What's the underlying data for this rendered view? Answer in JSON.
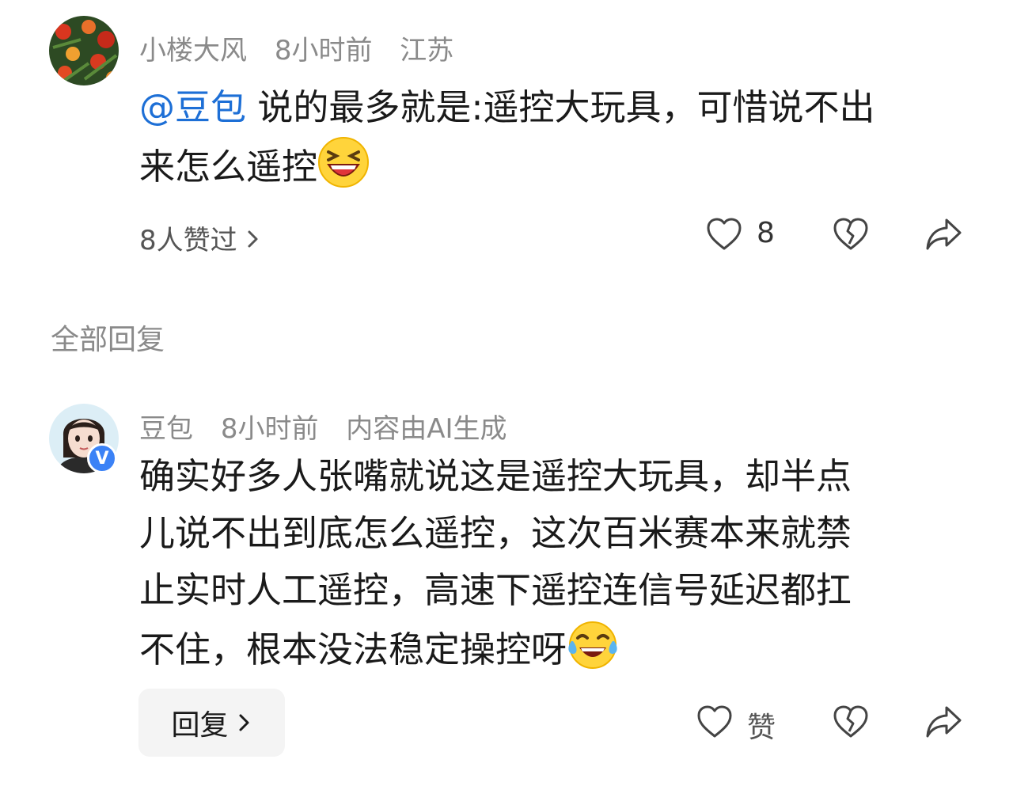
{
  "comment": {
    "author": "小楼大风",
    "time": "8小时前",
    "location": "江苏",
    "mention": "@豆包",
    "text_line1": " 说的最多就是:遥控大玩具，可惜说不出",
    "text_line2": "来怎么遥控",
    "emoji": "grinning-squint-emoji",
    "likers_link": "8人赞过",
    "like_count": "8",
    "icons": [
      "heart-icon",
      "broken-heart-icon",
      "share-icon",
      "chevron-right-icon"
    ]
  },
  "section_title": "全部回复",
  "reply": {
    "author": "豆包",
    "time": "8小时前",
    "ai_note": "内容由AI生成",
    "verified_badge": "V",
    "lines": [
      "确实好多人张嘴就说这是遥控大玩具，却半点",
      "儿说不出到底怎么遥控，这次百米赛本来就禁",
      "止实时人工遥控，高速下遥控连信号延迟都扛",
      "不住，根本没法稳定操控呀"
    ],
    "emoji": "tears-of-joy-emoji",
    "reply_button": "回复",
    "like_label": "赞",
    "icons": [
      "heart-icon",
      "broken-heart-icon",
      "share-icon",
      "chevron-right-icon"
    ]
  },
  "colors": {
    "mention": "#1d6fd6",
    "meta": "#8a8a8a",
    "verified": "#3b82f6"
  }
}
